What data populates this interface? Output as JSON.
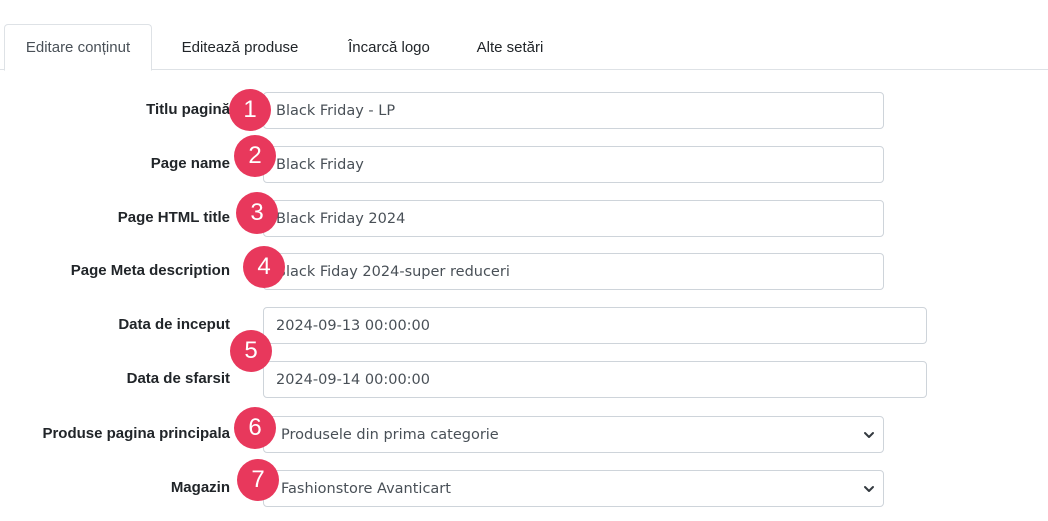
{
  "tabs": [
    {
      "label": "Editare conținut",
      "active": true
    },
    {
      "label": "Editează produse",
      "active": false
    },
    {
      "label": "Încarcă logo",
      "active": false
    },
    {
      "label": "Alte setări",
      "active": false
    }
  ],
  "form": {
    "page_title": {
      "label": "Titlu pagină",
      "value": "Black Friday - LP"
    },
    "page_name": {
      "label": "Page name",
      "value": "Black Friday"
    },
    "html_title": {
      "label": "Page HTML title",
      "value": "Black Friday 2024"
    },
    "meta_description": {
      "label": "Page Meta description",
      "value": "Black Fiday 2024-super reduceri"
    },
    "start_date": {
      "label": "Data de inceput",
      "value": "2024-09-13 00:00:00"
    },
    "end_date": {
      "label": "Data de sfarsit",
      "value": "2024-09-14 00:00:00"
    },
    "main_products": {
      "label": "Produse pagina principala",
      "value": "Produsele din prima categorie"
    },
    "store": {
      "label": "Magazin",
      "value": "Fashionstore Avanticart"
    }
  },
  "badges": [
    "1",
    "2",
    "3",
    "4",
    "5",
    "6",
    "7"
  ],
  "icons": {
    "select_arrow": "chevron-down-icon"
  },
  "colors": {
    "badge": "#e8385c",
    "border": "#ced4da"
  }
}
